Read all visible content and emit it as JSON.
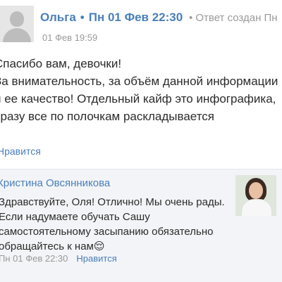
{
  "comment": {
    "author": "Ольга",
    "separator": "•",
    "datetime": "Пн 01 Фев 22:30",
    "created_label": "• Ответ создан Пн",
    "sub_date": "01 Фев 19:59",
    "text_lines": [
      "Спасибо вам, девочки!",
      "За внимательность, за объём данной информации",
      "и ее качество! Отдельный кайф это инфографика,",
      "сразу все по полочкам раскладывается"
    ],
    "like_label": "Нравится"
  },
  "reply": {
    "author": "Кристина Овсянникова",
    "text_lines": [
      "Здравствуйте, Оля! Отлично! Мы очень рады.",
      "Если надумаете обучать Сашу",
      "самостоятельному засыпанию обязательно",
      "обращайтесь к нам😌"
    ],
    "date": "Пн 01 Фев 22:30",
    "like_label": "Нравится"
  }
}
